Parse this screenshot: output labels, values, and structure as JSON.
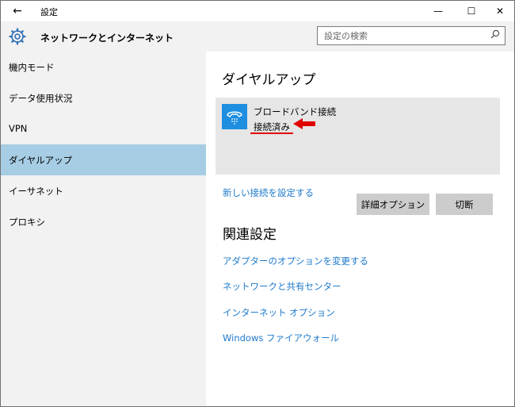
{
  "window": {
    "title": "設定"
  },
  "titlebar": {
    "back": "←",
    "minimize": "—",
    "maximize": "☐",
    "close": "✕"
  },
  "header": {
    "title": "ネットワークとインターネット",
    "search_placeholder": "設定の検索"
  },
  "sidebar": {
    "items": [
      {
        "label": "機内モード"
      },
      {
        "label": "データ使用状況"
      },
      {
        "label": "VPN"
      },
      {
        "label": "ダイヤルアップ",
        "active": true
      },
      {
        "label": "イーサネット"
      },
      {
        "label": "プロキシ"
      }
    ]
  },
  "main": {
    "heading": "ダイヤルアップ",
    "connection": {
      "name": "ブロードバンド接続",
      "status": "接続済み"
    },
    "buttons": {
      "advanced": "詳細オプション",
      "disconnect": "切断"
    },
    "new_connection_link": "新しい接続を設定する",
    "related_heading": "関連設定",
    "related_links": [
      "アダプターのオプションを変更する",
      "ネットワークと共有センター",
      "インターネット オプション",
      "Windows ファイアウォール"
    ]
  },
  "colors": {
    "accent": "#1d8ee0",
    "link": "#1f7acb",
    "selected": "#a6cde4",
    "annotation": "#e00000"
  }
}
